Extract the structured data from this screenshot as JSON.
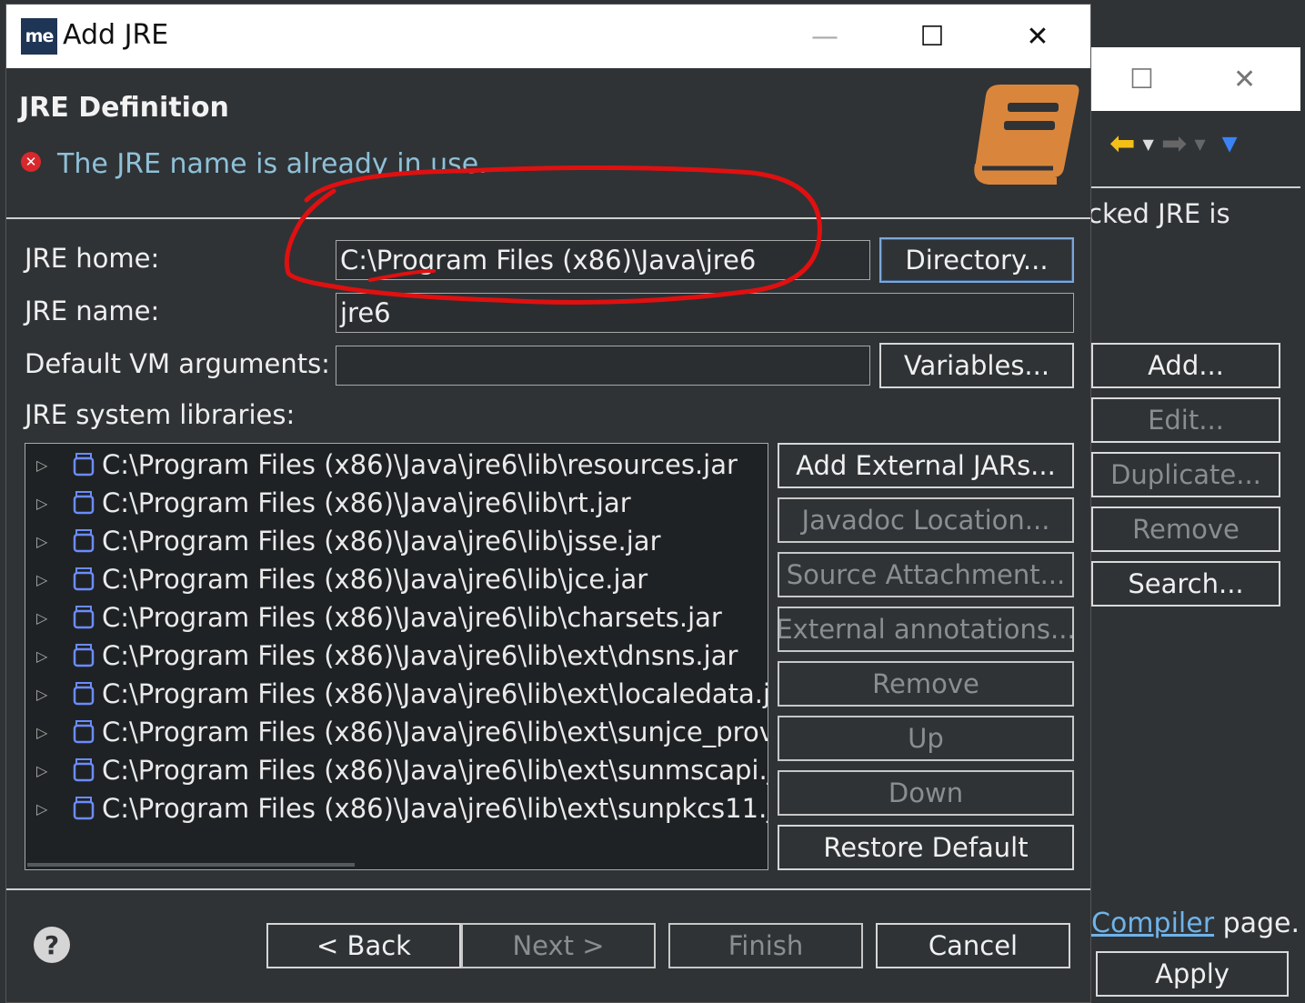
{
  "dialog": {
    "title": "Add JRE",
    "logo_text": "me",
    "banner_title": "JRE Definition",
    "error_message": "The JRE name is already in use.",
    "fields": {
      "jre_home_label": "JRE home:",
      "jre_home_value": "C:\\Program Files (x86)\\Java\\jre6",
      "jre_name_label": "JRE name:",
      "jre_name_value": "jre6",
      "vm_args_label": "Default VM arguments:",
      "vm_args_value": "",
      "libs_label": "JRE system libraries:"
    },
    "buttons": {
      "directory": "Directory...",
      "variables": "Variables...",
      "add_external_jars": "Add External JARs...",
      "javadoc_location": "Javadoc Location...",
      "source_attachment": "Source Attachment...",
      "external_annotations": "External annotations...",
      "remove": "Remove",
      "up": "Up",
      "down": "Down",
      "restore_default": "Restore Default",
      "back": "< Back",
      "next": "Next >",
      "finish": "Finish",
      "cancel": "Cancel"
    },
    "libraries": [
      "C:\\Program Files (x86)\\Java\\jre6\\lib\\resources.jar",
      "C:\\Program Files (x86)\\Java\\jre6\\lib\\rt.jar",
      "C:\\Program Files (x86)\\Java\\jre6\\lib\\jsse.jar",
      "C:\\Program Files (x86)\\Java\\jre6\\lib\\jce.jar",
      "C:\\Program Files (x86)\\Java\\jre6\\lib\\charsets.jar",
      "C:\\Program Files (x86)\\Java\\jre6\\lib\\ext\\dnsns.jar",
      "C:\\Program Files (x86)\\Java\\jre6\\lib\\ext\\localedata.j",
      "C:\\Program Files (x86)\\Java\\jre6\\lib\\ext\\sunjce_prov",
      "C:\\Program Files (x86)\\Java\\jre6\\lib\\ext\\sunmscapi.j",
      "C:\\Program Files (x86)\\Java\\jre6\\lib\\ext\\sunpkcs11.j"
    ]
  },
  "background_window": {
    "partial_text": "cked JRE is",
    "buttons": {
      "add": "Add...",
      "edit": "Edit...",
      "duplicate": "Duplicate...",
      "remove": "Remove",
      "search": "Search...",
      "apply": "Apply"
    },
    "compiler_link": "Compiler",
    "compiler_suffix": " page."
  },
  "colors": {
    "background": "#2f3336",
    "error_text": "#8fc0d8",
    "annotation_stroke": "#e01010",
    "book_icon": "#d9863c",
    "link": "#6fb3e8",
    "back_arrow": "#f3c017",
    "menu_arrow": "#3b82f6"
  }
}
